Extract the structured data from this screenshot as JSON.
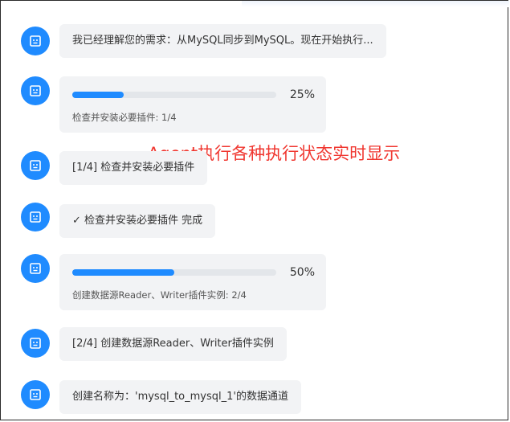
{
  "messages": [
    {
      "kind": "text",
      "text": "我已经理解您的需求：从MySQL同步到MySQL。现在开始执行..."
    },
    {
      "kind": "progress",
      "percent": 25,
      "percent_label": "25%",
      "caption": "检查并安装必要插件: 1/4"
    },
    {
      "kind": "text",
      "text": "[1/4] 检查并安装必要插件"
    },
    {
      "kind": "text",
      "text": "✓ 检查并安装必要插件 完成"
    },
    {
      "kind": "progress",
      "percent": 50,
      "percent_label": "50%",
      "caption": "创建数据源Reader、Writer插件实例: 2/4"
    },
    {
      "kind": "text",
      "text": "[2/4] 创建数据源Reader、Writer插件实例"
    },
    {
      "kind": "text",
      "text": "创建名称为：'mysql_to_mysql_1'的数据通道"
    }
  ],
  "annotation": "Agent执行各种执行状态实时显示",
  "icons": {
    "avatar": "robot-icon"
  },
  "colors": {
    "accent": "#1f8bff",
    "bubble": "#f2f3f5",
    "annotation": "#f0362f"
  }
}
